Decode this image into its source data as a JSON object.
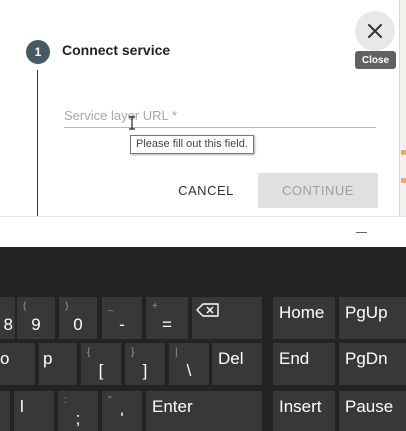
{
  "dialog": {
    "step_number": "1",
    "step_title": "Connect service",
    "url_field": {
      "placeholder": "Service layer URL *",
      "value": ""
    },
    "validation_tooltip": "Please fill out this field.",
    "cancel_label": "CANCEL",
    "continue_label": "CONTINUE",
    "close_tooltip": "Close"
  },
  "keyboard": {
    "row1": [
      {
        "sub": "",
        "main": "8"
      },
      {
        "sub": "(",
        "main": "9"
      },
      {
        "sub": ")",
        "main": "0"
      },
      {
        "sub": "_",
        "main": "-"
      },
      {
        "sub": "+",
        "main": "="
      },
      {
        "icon": "backspace-icon"
      },
      {
        "main": "Home"
      },
      {
        "main": "PgUp"
      }
    ],
    "row2": [
      {
        "main": "o"
      },
      {
        "main": "p"
      },
      {
        "sub": "{",
        "main": "["
      },
      {
        "sub": "}",
        "main": "]"
      },
      {
        "sub": "|",
        "main": "\\"
      },
      {
        "main": "Del"
      },
      {
        "main": "End"
      },
      {
        "main": "PgDn"
      }
    ],
    "row3": [
      {
        "main": ""
      },
      {
        "main": "l"
      },
      {
        "sub": ":",
        "main": ";"
      },
      {
        "sub": "\"",
        "main": "'"
      },
      {
        "main": "Enter"
      },
      {
        "main": "Insert"
      },
      {
        "main": "Pause"
      }
    ]
  },
  "colors": {
    "step_dot": "#455a64",
    "keyboard_bg": "#232323",
    "key_bg": "#383838",
    "disabled_button": "#e0e0e0"
  }
}
